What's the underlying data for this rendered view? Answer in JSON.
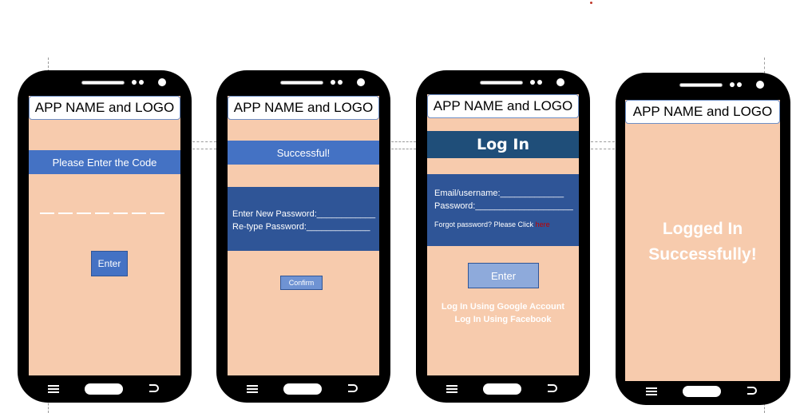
{
  "app_name": "APP NAME and LOGO",
  "screen_code": {
    "banner": "Please Enter the Code",
    "enter_button": "Enter"
  },
  "screen_reset": {
    "banner": "Successful!",
    "new_password_label": "Enter New Password:____________",
    "retype_password_label": "Re-type Password:_____________",
    "confirm_button": "Confirm"
  },
  "screen_login": {
    "title": "Log In",
    "email_label": "Email/username:_____________",
    "password_label": "Password:____________________",
    "forgot_text": "Forgot password? Please Click",
    "forgot_link": "here",
    "enter_button": "Enter",
    "google_login": "Log In Using Google Account",
    "facebook_login": "Log In Using Facebook"
  },
  "screen_success": {
    "line1": "Logged In",
    "line2": "Successfully!"
  },
  "colors": {
    "screen_bg": "#f7cbad",
    "banner_blue": "#4472c4",
    "panel_dark_blue": "#2f5597",
    "title_bar": "#1f4e79",
    "link_red": "#c00000"
  }
}
